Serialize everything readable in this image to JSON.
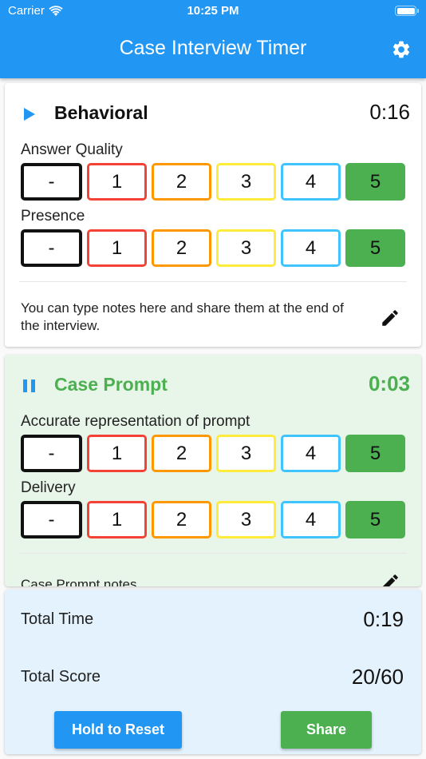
{
  "status_bar": {
    "carrier": "Carrier",
    "time": "10:25 PM",
    "battery_level": 1.0
  },
  "app_bar": {
    "title": "Case Interview Timer",
    "settings_icon": "gear-icon"
  },
  "sections": [
    {
      "title": "Behavioral",
      "time": "0:16",
      "state": "paused",
      "control_icon": "play-icon",
      "criteria": [
        {
          "label": "Answer Quality",
          "options": [
            "-",
            "1",
            "2",
            "3",
            "4",
            "5"
          ],
          "selected": "5"
        },
        {
          "label": "Presence",
          "options": [
            "-",
            "1",
            "2",
            "3",
            "4",
            "5"
          ],
          "selected": "5"
        }
      ],
      "notes": "You can type notes here and share them at the end of the interview.",
      "notes_icon": "pencil-icon"
    },
    {
      "title": "Case Prompt",
      "time": "0:03",
      "state": "running",
      "control_icon": "pause-icon",
      "criteria": [
        {
          "label": "Accurate representation of prompt",
          "options": [
            "-",
            "1",
            "2",
            "3",
            "4",
            "5"
          ],
          "selected": "5"
        },
        {
          "label": "Delivery",
          "options": [
            "-",
            "1",
            "2",
            "3",
            "4",
            "5"
          ],
          "selected": "5"
        }
      ],
      "notes": "Case Prompt notes",
      "notes_icon": "pencil-icon"
    }
  ],
  "score_colors": {
    "-": "#111111",
    "1": "#f44336",
    "2": "#ff9800",
    "3": "#ffeb3b",
    "4": "#40c4ff",
    "5": "#4caf50"
  },
  "summary": {
    "total_time_label": "Total Time",
    "total_time": "0:19",
    "total_score_label": "Total Score",
    "total_score": "20/60",
    "reset_label": "Hold to Reset",
    "share_label": "Share"
  },
  "colors": {
    "primary": "#2196f3",
    "accent_green": "#4caf50",
    "active_bg": "#e8f5e9",
    "summary_bg": "#e3f2fd"
  }
}
